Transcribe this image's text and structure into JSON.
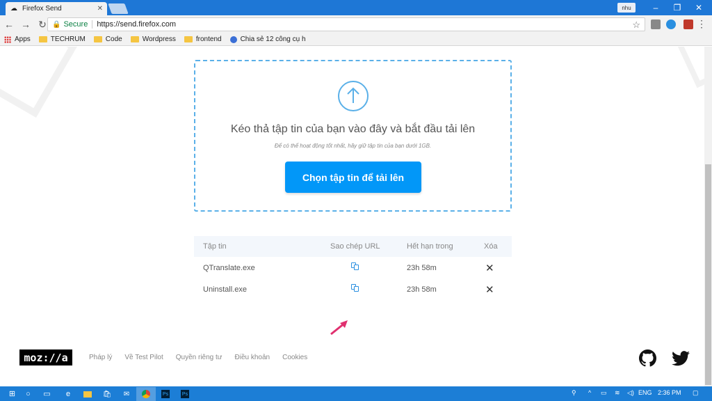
{
  "browser": {
    "tab_title": "Firefox Send",
    "tab_close": "✕",
    "user_label": "nhu",
    "secure_label": "Secure",
    "url": "https://send.firefox.com",
    "bookmarks": [
      {
        "label": "Apps",
        "icon": "apps-grid-icon"
      },
      {
        "label": "TECHRUM",
        "icon": "folder-icon"
      },
      {
        "label": "Code",
        "icon": "folder-icon"
      },
      {
        "label": "Wordpress",
        "icon": "folder-icon"
      },
      {
        "label": "frontend",
        "icon": "folder-icon"
      },
      {
        "label": "Chia sẻ 12 công cụ h",
        "icon": "globe-icon"
      }
    ]
  },
  "upload": {
    "title": "Kéo thả tập tin của bạn vào đây và bắt đầu tải lên",
    "subtitle": "Để có thể hoạt động tốt nhất, hãy giữ tập tin của bạn dưới 1GB.",
    "button": "Chọn tập tin để tải lên"
  },
  "table": {
    "headers": [
      "Tập tin",
      "Sao chép URL",
      "Hết hạn trong",
      "Xóa"
    ],
    "rows": [
      {
        "file": "QTranslate.exe",
        "expires": "23h 58m"
      },
      {
        "file": "Uninstall.exe",
        "expires": "23h 58m"
      }
    ],
    "delete_glyph": "✕"
  },
  "footer": {
    "logo": "moz://a",
    "links": [
      "Pháp lý",
      "Về Test Pilot",
      "Quyền riêng tư",
      "Điều khoản",
      "Cookies"
    ]
  },
  "taskbar": {
    "lang": "ENG",
    "time": "2:36 PM"
  },
  "colors": {
    "accent": "#0297f8",
    "dropzone_border": "#5ab0e8",
    "annotation_arrow": "#e0306f",
    "taskbar": "#1c7ed6"
  }
}
